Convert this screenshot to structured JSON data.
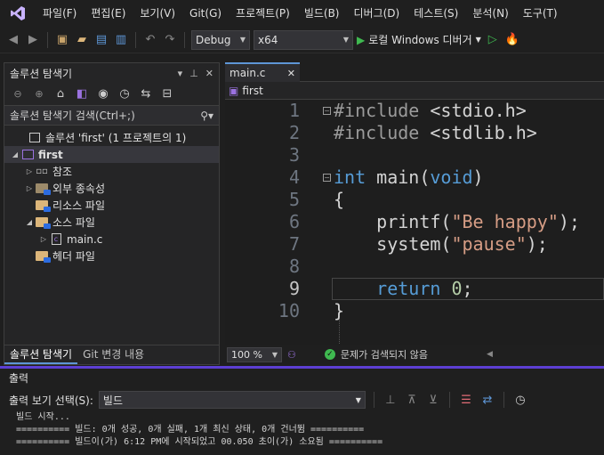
{
  "menu": {
    "items": [
      "파일(F)",
      "편집(E)",
      "보기(V)",
      "Git(G)",
      "프로젝트(P)",
      "빌드(B)",
      "디버그(D)",
      "테스트(S)",
      "분석(N)",
      "도구(T)"
    ]
  },
  "toolbar": {
    "config": "Debug",
    "platform": "x64",
    "run_label": "로컬 Windows 디버거"
  },
  "solution_explorer": {
    "title": "솔루션 탐색기",
    "search_placeholder": "솔루션 탐색기 검색(Ctrl+;)",
    "tree": [
      {
        "label": "솔루션 'first' (1 프로젝트의 1)",
        "level": 0,
        "caret": ""
      },
      {
        "label": "first",
        "level": 0,
        "caret": "◢"
      },
      {
        "label": "참조",
        "level": 1,
        "caret": "▷"
      },
      {
        "label": "외부 종속성",
        "level": 1,
        "caret": "▷"
      },
      {
        "label": "리소스 파일",
        "level": 1,
        "caret": ""
      },
      {
        "label": "소스 파일",
        "level": 1,
        "caret": "◢"
      },
      {
        "label": "main.c",
        "level": 2,
        "caret": "▷"
      },
      {
        "label": "헤더 파일",
        "level": 1,
        "caret": ""
      }
    ],
    "tabs": [
      "솔루션 탐색기",
      "Git 변경 내용"
    ]
  },
  "editor": {
    "tab_label": "main.c",
    "nav_label": "first",
    "zoom": "100 %",
    "status_text": "문제가 검색되지 않음",
    "current_line": 9,
    "lines": [
      {
        "n": "1",
        "text": "#include <stdio.h>"
      },
      {
        "n": "2",
        "text": "#include <stdlib.h>"
      },
      {
        "n": "3",
        "text": ""
      },
      {
        "n": "4",
        "text": "int main(void)"
      },
      {
        "n": "5",
        "text": "{"
      },
      {
        "n": "6",
        "text": "    printf(\"Be happy\");"
      },
      {
        "n": "7",
        "text": "    system(\"pause\");"
      },
      {
        "n": "8",
        "text": ""
      },
      {
        "n": "9",
        "text": "    return 0;"
      },
      {
        "n": "10",
        "text": "}"
      }
    ]
  },
  "output": {
    "title": "출력",
    "select_label": "출력 보기 선택(S):",
    "select_value": "빌드",
    "lines": [
      "빌드 시작...",
      "========== 빌드: 0개 성공, 0개 실패, 1개 최신 상태, 0개 건너뜀 ==========",
      "========== 빌드이(가) 6:12 PM에 시작되었고 00.050 초이(가) 소요됨 =========="
    ]
  },
  "colors": {
    "accent": "#5d3fd3",
    "keyword": "#569cd6",
    "string": "#d69d85",
    "number": "#b5cea8"
  }
}
